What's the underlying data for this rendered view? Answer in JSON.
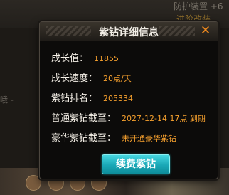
{
  "background": {
    "top_text": "防护装置 +6",
    "top_link": "进阶改装",
    "left_text": "哦~"
  },
  "dialog": {
    "title": "紫钻详细信息",
    "close_label": "✕",
    "rows": [
      {
        "label": "成长值：",
        "value": "11855"
      },
      {
        "label": "成长速度：",
        "value": "20点/天"
      },
      {
        "label": "紫钻排名：",
        "value": "205334"
      },
      {
        "label": "普通紫钻截至：",
        "value": "2027-12-14 17点 到期"
      },
      {
        "label": "豪华紫钻截至：",
        "value": "未开通豪华紫钻"
      }
    ],
    "renew_button": "续费紫钻"
  },
  "colors": {
    "value": "#f6a02e",
    "close": "#f18a1d",
    "button": "#19a7b6"
  }
}
